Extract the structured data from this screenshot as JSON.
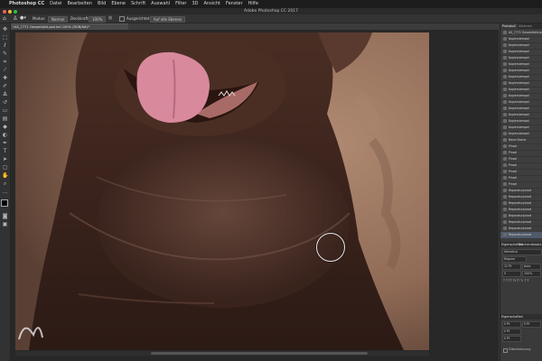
{
  "menubar": {
    "apple": "",
    "items": [
      "Photoshop CC",
      "Datei",
      "Bearbeiten",
      "Bild",
      "Ebene",
      "Schrift",
      "Auswahl",
      "Filter",
      "3D",
      "Ansicht",
      "Fenster",
      "Hilfe"
    ]
  },
  "window": {
    "title": "Adobe Photoshop CC 2017"
  },
  "options": {
    "mode_label": "Modus:",
    "mode_value": "Normal",
    "opacity_label": "Deckkraft:",
    "opacity_value": "100%",
    "sample_button": "Auf alle Ebenen",
    "align_label": "Ausgerichtet"
  },
  "document": {
    "tab_label": "AS_7771 Gesamtbild.psd bei 100% (RGB/8#)*"
  },
  "tools": [
    "move",
    "marquee",
    "lasso",
    "quick-select",
    "crop",
    "eyedropper",
    "healing",
    "brush",
    "clone-stamp",
    "history-brush",
    "eraser",
    "gradient",
    "blur",
    "dodge",
    "pen",
    "type",
    "path-select",
    "shape",
    "hand",
    "zoom",
    "more",
    "colors",
    "quickmask",
    "screenmode"
  ],
  "panel": {
    "tabs": [
      "Protokoll",
      "Aktionen"
    ],
    "history": [
      "AS_7771 Gesamtbild.psd",
      "Kopierstempel",
      "Kopierstempel",
      "Kopierstempel",
      "Kopierstempel",
      "Kopierstempel",
      "Kopierstempel",
      "Kopierstempel",
      "Kopierstempel",
      "Kopierstempel",
      "Kopierstempel",
      "Kopierstempel",
      "Kopierstempel",
      "Kopierstempel",
      "Kopierstempel",
      "Kopierstempel",
      "Kopierstempel",
      "Neue Ebene",
      "Pinsel",
      "Pinsel",
      "Pinsel",
      "Pinsel",
      "Pinsel",
      "Pinsel",
      "Pinsel",
      "Reparaturpinsel",
      "Reparaturpinsel",
      "Reparaturpinsel",
      "Reparaturpinsel",
      "Reparaturpinsel",
      "Reparaturpinsel",
      "Reparaturpinsel",
      "Reparaturpinsel"
    ],
    "selected_index": 32,
    "char_tabs": [
      "Eigenschaften",
      "Zeichen",
      "Absatz"
    ],
    "char_rows": [
      "Helvetica",
      "Regular",
      "12 Pt",
      "Auto",
      "0",
      "100%"
    ],
    "para_header": "Eigenschaften",
    "para_rows": [
      "0 Pt",
      "0 Pt",
      "0 Pt",
      "0 Pt"
    ],
    "bottom_check": "Silbentrennung"
  },
  "colors": {
    "accent": "#4f5a6a",
    "traffic_red": "#ff5f57",
    "traffic_yellow": "#febc2e",
    "traffic_green": "#28c840"
  }
}
